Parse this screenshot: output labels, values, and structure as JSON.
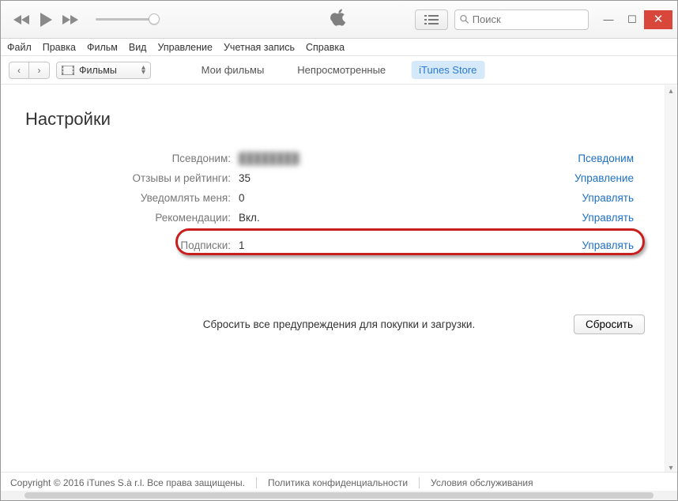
{
  "search": {
    "placeholder": "Поиск"
  },
  "menubar": [
    "Файл",
    "Правка",
    "Фильм",
    "Вид",
    "Управление",
    "Учетная запись",
    "Справка"
  ],
  "mediaSelector": {
    "label": "Фильмы"
  },
  "tabs": [
    {
      "label": "Мои фильмы",
      "active": false
    },
    {
      "label": "Непросмотренные",
      "active": false
    },
    {
      "label": "iTunes Store",
      "active": true
    }
  ],
  "settings": {
    "title": "Настройки",
    "rows": [
      {
        "label": "Псевдоним:",
        "value": "████████",
        "blurred": true,
        "action": "Псевдоним"
      },
      {
        "label": "Отзывы и рейтинги:",
        "value": "35",
        "action": "Управление"
      },
      {
        "label": "Уведомлять меня:",
        "value": "0",
        "action": "Управлять"
      },
      {
        "label": "Рекомендации:",
        "value": "Вкл.",
        "action": "Управлять"
      }
    ],
    "highlightedRow": {
      "label": "Подписки:",
      "value": "1",
      "action": "Управлять"
    },
    "resetText": "Сбросить все предупреждения для покупки и загрузки.",
    "resetButton": "Сбросить"
  },
  "footer": {
    "copyright": "Copyright © 2016 iTunes S.à r.l. Все права защищены.",
    "privacy": "Политика конфиденциальности",
    "terms": "Условия обслуживания"
  }
}
